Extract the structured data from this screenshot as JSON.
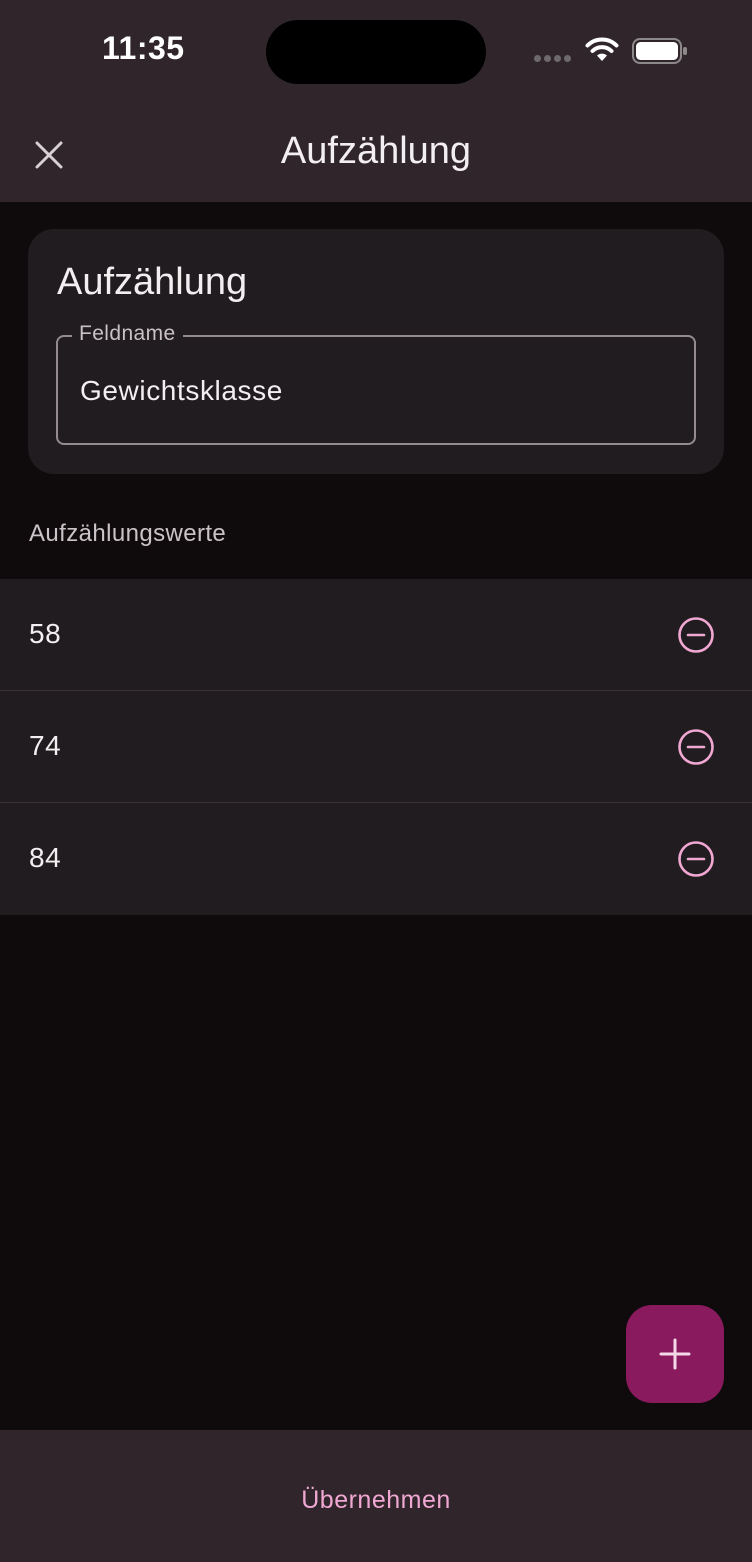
{
  "status_bar": {
    "time": "11:35"
  },
  "app_bar": {
    "title": "Aufzählung",
    "close_icon": "close-icon"
  },
  "card": {
    "title": "Aufzählung",
    "field": {
      "label": "Feldname",
      "value": "Gewichtsklasse"
    }
  },
  "section": {
    "label": "Aufzählungswerte"
  },
  "values": [
    {
      "value": "58",
      "icon": "remove-circle-icon"
    },
    {
      "value": "74",
      "icon": "remove-circle-icon"
    },
    {
      "value": "84",
      "icon": "remove-circle-icon"
    }
  ],
  "fab": {
    "icon": "plus-icon"
  },
  "bottom_bar": {
    "apply_label": "Übernehmen"
  },
  "colors": {
    "bar_background": "#2f252b",
    "page_background": "#0f0b0d",
    "surface": "#211c1f",
    "accent": "#f0a8d2",
    "fab": "#8a1a5e"
  }
}
